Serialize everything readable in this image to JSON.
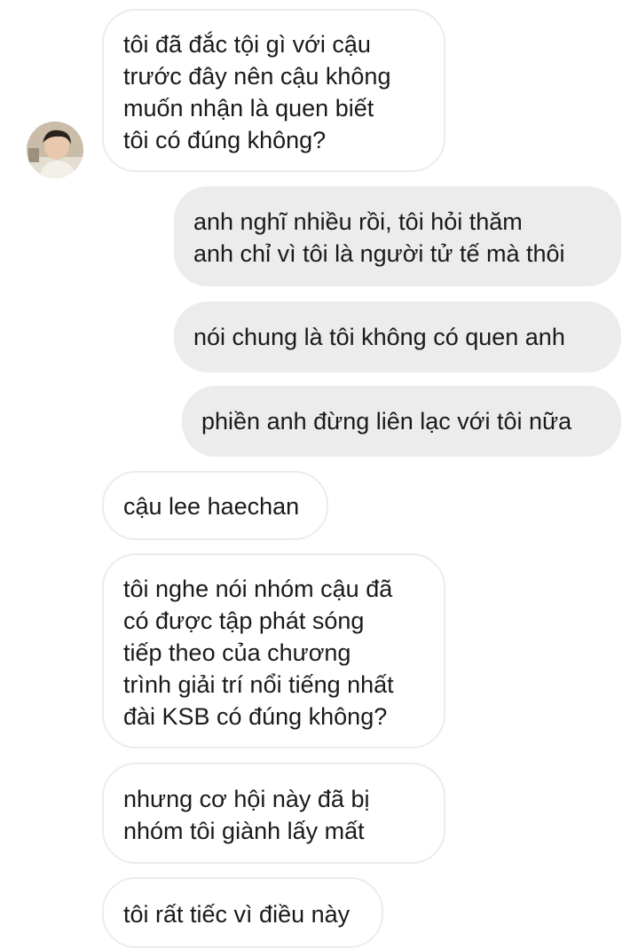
{
  "contact": {
    "avatar_icon": "user-avatar-photo"
  },
  "messages": [
    {
      "direction": "incoming",
      "text": "tôi đã đắc tội gì với cậu\ntrước đây nên cậu không\nmuốn nhận là quen biết\ntôi có đúng không?"
    },
    {
      "direction": "outgoing",
      "text": "anh nghĩ nhiều rồi, tôi hỏi thăm\nanh chỉ vì tôi là người tử tế mà thôi"
    },
    {
      "direction": "outgoing",
      "text": "nói chung là tôi không có quen anh"
    },
    {
      "direction": "outgoing",
      "text": "phiền anh đừng liên lạc với tôi nữa"
    },
    {
      "direction": "incoming",
      "text": "cậu lee haechan"
    },
    {
      "direction": "incoming",
      "text": "tôi nghe nói nhóm cậu đã\ncó được tập phát sóng\ntiếp theo của chương\ntrình giải trí nổi tiếng nhất\nđài KSB có đúng không?"
    },
    {
      "direction": "incoming",
      "text": "nhưng cơ hội này đã bị\nnhóm tôi giành lấy mất"
    },
    {
      "direction": "incoming",
      "text": "tôi rất tiếc vì điều này"
    }
  ],
  "colors": {
    "outgoing_bubble": "#ececec",
    "incoming_border": "#ececec",
    "text": "#1a1a1a"
  }
}
